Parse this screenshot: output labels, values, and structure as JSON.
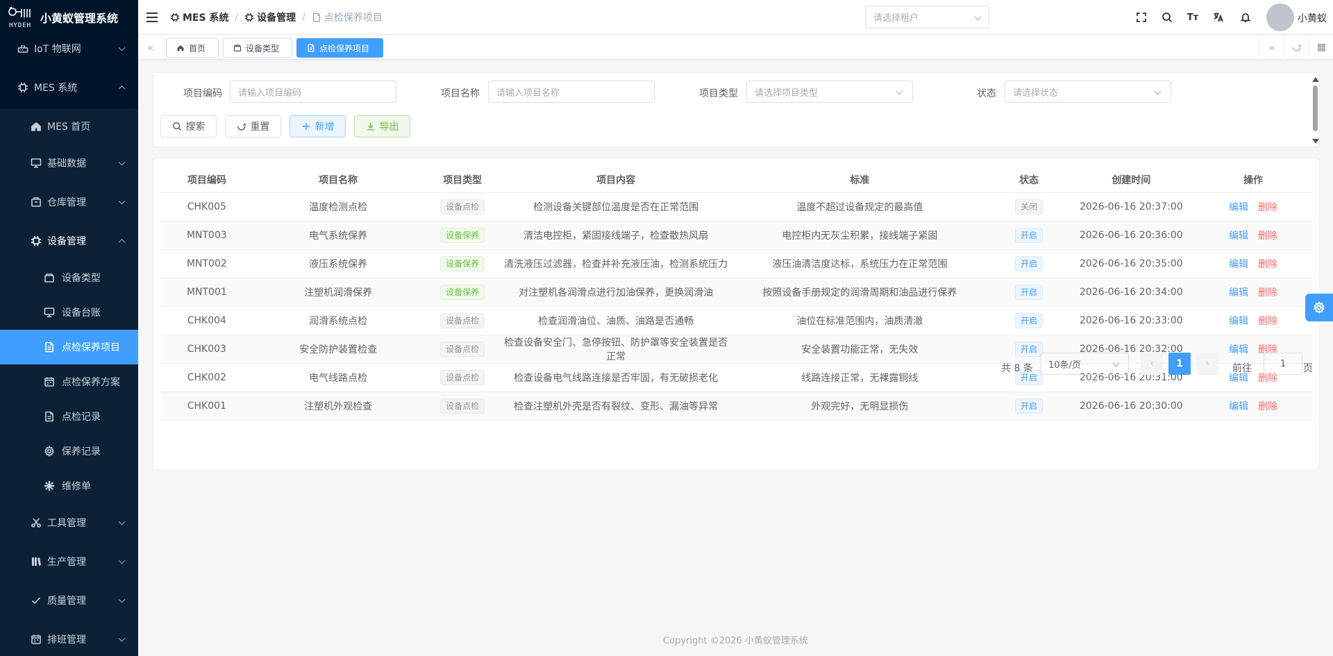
{
  "app": {
    "title": "小黄蚁管理系统",
    "logo_text": "HYDEH"
  },
  "sidebar": {
    "items": [
      {
        "label": "IoT 物联网",
        "icon": "router-icon",
        "level": 1,
        "expanded": false
      },
      {
        "label": "MES 系统",
        "icon": "chip-icon",
        "level": 1,
        "expanded": true
      },
      {
        "label": "MES 首页",
        "icon": "home-icon",
        "level": 2
      },
      {
        "label": "基础数据",
        "icon": "monitor-icon",
        "level": 2,
        "expanded": false
      },
      {
        "label": "仓库管理",
        "icon": "warehouse-icon",
        "level": 2,
        "expanded": false
      },
      {
        "label": "设备管理",
        "icon": "chip-icon",
        "level": 2,
        "expanded": true
      },
      {
        "label": "设备类型",
        "icon": "box-icon",
        "level": 3
      },
      {
        "label": "设备台账",
        "icon": "monitor-icon",
        "level": 3
      },
      {
        "label": "点检保养项目",
        "icon": "document-icon",
        "level": 3,
        "active": true
      },
      {
        "label": "点检保养方案",
        "icon": "calendar-icon",
        "level": 3
      },
      {
        "label": "点检记录",
        "icon": "document-icon",
        "level": 3
      },
      {
        "label": "保养记录",
        "icon": "gear-icon",
        "level": 3
      },
      {
        "label": "维修单",
        "icon": "gear-icon",
        "level": 3
      },
      {
        "label": "工具管理",
        "icon": "scissors-icon",
        "level": 2,
        "expanded": false
      },
      {
        "label": "生产管理",
        "icon": "books-icon",
        "level": 2,
        "expanded": false
      },
      {
        "label": "质量管理",
        "icon": "check-icon",
        "level": 2,
        "expanded": false
      },
      {
        "label": "排班管理",
        "icon": "calendar-icon",
        "level": 2,
        "expanded": false
      }
    ]
  },
  "header": {
    "breadcrumb": [
      "MES 系统",
      "设备管理",
      "点检保养项目"
    ],
    "tenant_placeholder": "请选择租户",
    "size_icon_text": "Tт",
    "username": "小黄蚁"
  },
  "tags": [
    {
      "label": "首页",
      "icon": "home-icon"
    },
    {
      "label": "设备类型",
      "icon": "box-icon"
    },
    {
      "label": "点检保养项目",
      "icon": "document-icon",
      "active": true
    }
  ],
  "search": {
    "fields": [
      {
        "label": "项目编码",
        "placeholder": "请输入项目编码",
        "type": "input"
      },
      {
        "label": "项目名称",
        "placeholder": "请输入项目名称",
        "type": "input"
      },
      {
        "label": "项目类型",
        "placeholder": "请选择项目类型",
        "type": "select"
      },
      {
        "label": "状态",
        "placeholder": "请选择状态",
        "type": "select"
      }
    ],
    "buttons": {
      "search": "搜索",
      "reset": "重置",
      "add": "新增",
      "export": "导出"
    }
  },
  "table": {
    "columns": [
      "项目编码",
      "项目名称",
      "项目类型",
      "项目内容",
      "标准",
      "状态",
      "创建时间",
      "操作"
    ],
    "actions": {
      "edit": "编辑",
      "delete": "删除"
    },
    "rows": [
      {
        "code": "CHK005",
        "name": "温度检测点检",
        "type": "设备点检",
        "content": "检测设备关键部位温度是否在正常范围",
        "standard": "温度不超过设备规定的最高值",
        "status": "关闭",
        "time": "2026-06-16 20:37:00"
      },
      {
        "code": "MNT003",
        "name": "电气系统保养",
        "type": "设备保养",
        "content": "清洁电控柜，紧固接线端子，检查散热风扇",
        "standard": "电控柜内无灰尘积累，接线端子紧固",
        "status": "开启",
        "time": "2026-06-16 20:36:00"
      },
      {
        "code": "MNT002",
        "name": "液压系统保养",
        "type": "设备保养",
        "content": "清洗液压过滤器，检查并补充液压油，检测系统压力",
        "standard": "液压油清洁度达标，系统压力在正常范围",
        "status": "开启",
        "time": "2026-06-16 20:35:00"
      },
      {
        "code": "MNT001",
        "name": "注塑机润滑保养",
        "type": "设备保养",
        "content": "对注塑机各润滑点进行加油保养，更换润滑油",
        "standard": "按照设备手册规定的润滑周期和油品进行保养",
        "status": "开启",
        "time": "2026-06-16 20:34:00"
      },
      {
        "code": "CHK004",
        "name": "润滑系统点检",
        "type": "设备点检",
        "content": "检查润滑油位、油质、油路是否通畅",
        "standard": "油位在标准范围内，油质清澈",
        "status": "开启",
        "time": "2026-06-16 20:33:00"
      },
      {
        "code": "CHK003",
        "name": "安全防护装置检查",
        "type": "设备点检",
        "content": "检查设备安全门、急停按钮、防护罩等安全装置是否正常",
        "standard": "安全装置功能正常，无失效",
        "status": "开启",
        "time": "2026-06-16 20:32:00"
      },
      {
        "code": "CHK002",
        "name": "电气线路点检",
        "type": "设备点检",
        "content": "检查设备电气线路连接是否牢固，有无破损老化",
        "standard": "线路连接正常，无裸露铜线",
        "status": "开启",
        "time": "2026-06-16 20:31:00"
      },
      {
        "code": "CHK001",
        "name": "注塑机外观检查",
        "type": "设备点检",
        "content": "检查注塑机外壳是否有裂纹、变形、漏油等异常",
        "standard": "外观完好，无明显损伤",
        "status": "开启",
        "time": "2026-06-16 20:30:00"
      }
    ]
  },
  "pagination": {
    "total_text": "共 8 条",
    "page_size": "10条/页",
    "current": "1",
    "goto_prefix": "前往",
    "goto_value": "1",
    "goto_suffix": "页"
  },
  "footer": {
    "copyright": "Copyright ©2026 小黄蚁管理系统"
  },
  "colors": {
    "sidebar_bg": "#001529",
    "accent": "#409eff",
    "success": "#67c23a",
    "danger": "#f56c6c"
  }
}
